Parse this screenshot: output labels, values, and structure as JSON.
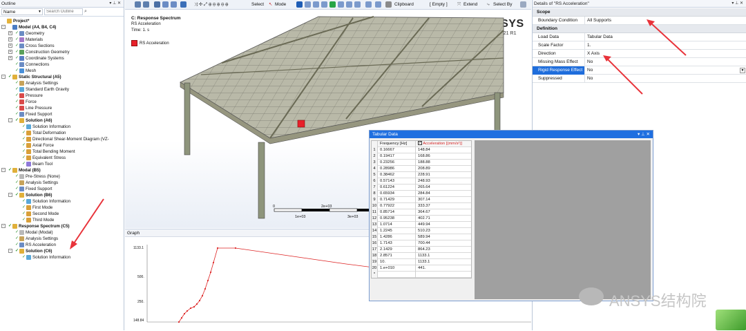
{
  "outline": {
    "title": "Outline",
    "filter_label": "Name",
    "search_placeholder": "Search Outline",
    "items": [
      {
        "label": "Project*",
        "bold": true
      },
      {
        "label": "Model (A4, B4, C4)",
        "bold": true
      },
      {
        "label": "Geometry"
      },
      {
        "label": "Materials"
      },
      {
        "label": "Cross Sections"
      },
      {
        "label": "Construction Geometry"
      },
      {
        "label": "Coordinate Systems"
      },
      {
        "label": "Connections"
      },
      {
        "label": "Mesh"
      },
      {
        "label": "Static Structural (A5)",
        "bold": true
      },
      {
        "label": "Analysis Settings"
      },
      {
        "label": "Standard Earth Gravity"
      },
      {
        "label": "Pressure"
      },
      {
        "label": "Force"
      },
      {
        "label": "Line Pressure"
      },
      {
        "label": "Fixed Support"
      },
      {
        "label": "Solution (A6)",
        "bold": true
      },
      {
        "label": "Solution Information"
      },
      {
        "label": "Total Deformation"
      },
      {
        "label": "Directional Shear-Moment Diagram (VZ-"
      },
      {
        "label": "Axial Force"
      },
      {
        "label": "Total Bending Moment"
      },
      {
        "label": "Equivalent Stress"
      },
      {
        "label": "Beam Tool"
      },
      {
        "label": "Modal (B5)",
        "bold": true
      },
      {
        "label": "Pre-Stress (None)"
      },
      {
        "label": "Analysis Settings"
      },
      {
        "label": "Fixed Support"
      },
      {
        "label": "Solution (B6)",
        "bold": true
      },
      {
        "label": "Solution Information"
      },
      {
        "label": "First Mode"
      },
      {
        "label": "Second Mode"
      },
      {
        "label": "Third Mode"
      },
      {
        "label": "Response Spectrum (C5)",
        "bold": true
      },
      {
        "label": "Modal (Modal)"
      },
      {
        "label": "Analysis Settings"
      },
      {
        "label": "RS Acceleration"
      },
      {
        "label": "Solution (C6)",
        "bold": true
      },
      {
        "label": "Solution Information"
      }
    ]
  },
  "toolbar": {
    "select_label": "Select",
    "mode_label": "Mode",
    "clipboard_label": "Clipboard",
    "empty_label": "[ Empty ]",
    "extend_label": "Extend",
    "select_by_label": "Select By"
  },
  "viewport": {
    "heading": "C: Response Spectrum",
    "sub1": "RS Acceleration",
    "sub2": "Time: 1. s",
    "legend_label": "RS Acceleration",
    "brand": "ANSYS",
    "brand_version": "2021 R1",
    "scale_labels": [
      "0",
      "2e+03",
      "1e+03",
      "3e+03"
    ],
    "accent": "#e8202a"
  },
  "graph": {
    "title": "Graph",
    "y_ticks": [
      "1133.1",
      "500.",
      "250.",
      "148.84"
    ]
  },
  "details": {
    "title": "Details of \"RS Acceleration\"",
    "sections": [
      {
        "label": "Scope",
        "rows": [
          {
            "key": "Boundary Condition",
            "value": "All Supports"
          }
        ]
      },
      {
        "label": "Definition",
        "rows": [
          {
            "key": "Load Data",
            "value": "Tabular Data"
          },
          {
            "key": "Scale Factor",
            "value": "1."
          },
          {
            "key": "Direction",
            "value": "X Axis"
          },
          {
            "key": "Missing Mass Effect",
            "value": "No"
          },
          {
            "key": "Rigid Response Effect",
            "value": "No"
          },
          {
            "key": "Suppressed",
            "value": "No"
          }
        ]
      }
    ]
  },
  "tabular": {
    "title": "Tabular Data",
    "col_frequency": "Frequency [Hz]",
    "col_acceleration": "Acceleration [(mm/s²)]",
    "rows": [
      [
        "1",
        "0.16667",
        "148.84"
      ],
      [
        "2",
        "0.19417",
        "168.86"
      ],
      [
        "3",
        "0.23256",
        "188.88"
      ],
      [
        "4",
        "0.28986",
        "208.89"
      ],
      [
        "5",
        "0.38462",
        "228.91"
      ],
      [
        "6",
        "0.57143",
        "248.93"
      ],
      [
        "7",
        "0.61224",
        "265.64"
      ],
      [
        "8",
        "0.65934",
        "284.84"
      ],
      [
        "9",
        "0.71429",
        "307.14"
      ],
      [
        "10",
        "0.77922",
        "333.37"
      ],
      [
        "11",
        "0.85714",
        "364.67"
      ],
      [
        "12",
        "0.95238",
        "402.71"
      ],
      [
        "13",
        "1.0714",
        "449.94"
      ],
      [
        "14",
        "1.2245",
        "510.23"
      ],
      [
        "15",
        "1.4286",
        "589.94"
      ],
      [
        "16",
        "1.7143",
        "700.44"
      ],
      [
        "17",
        "2.1429",
        "864.23"
      ],
      [
        "18",
        "2.8571",
        "1133.1"
      ],
      [
        "19",
        "10.",
        "1133.1"
      ],
      [
        "20",
        "1.e+010",
        "441."
      ],
      [
        "*",
        "",
        ""
      ]
    ]
  },
  "watermark": "ANSYS结构院"
}
